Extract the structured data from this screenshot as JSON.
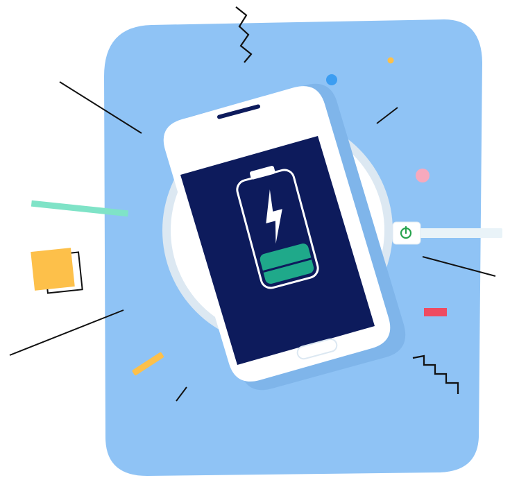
{
  "illustration": {
    "subject": "smartphone-on-wireless-charging-pad",
    "battery_charge_level": 0.3,
    "icons": {
      "battery": "battery-icon",
      "bolt": "lightning-bolt-icon",
      "power": "power-icon"
    },
    "colors": {
      "background_card": "#8fc3f5",
      "background_card_shadow": "#7fb5ea",
      "charging_pad": "#ffffff",
      "pad_ring": "#dce8f2",
      "phone_body": "#ffffff",
      "phone_screen": "#0d1b5c",
      "screen_shade": "#0a1547",
      "battery_fill": "#1fa98a",
      "battery_outline": "#ffffff",
      "cable": "#e9f3f8",
      "cable_plug_accent": "#27a34d",
      "accent_yellow": "#fdc04a",
      "accent_teal": "#7fe3c7",
      "accent_pink": "#f7a9bd",
      "accent_red": "#ef4b61",
      "accent_blue_dot": "#3c9df1",
      "line_black": "#111111"
    }
  }
}
